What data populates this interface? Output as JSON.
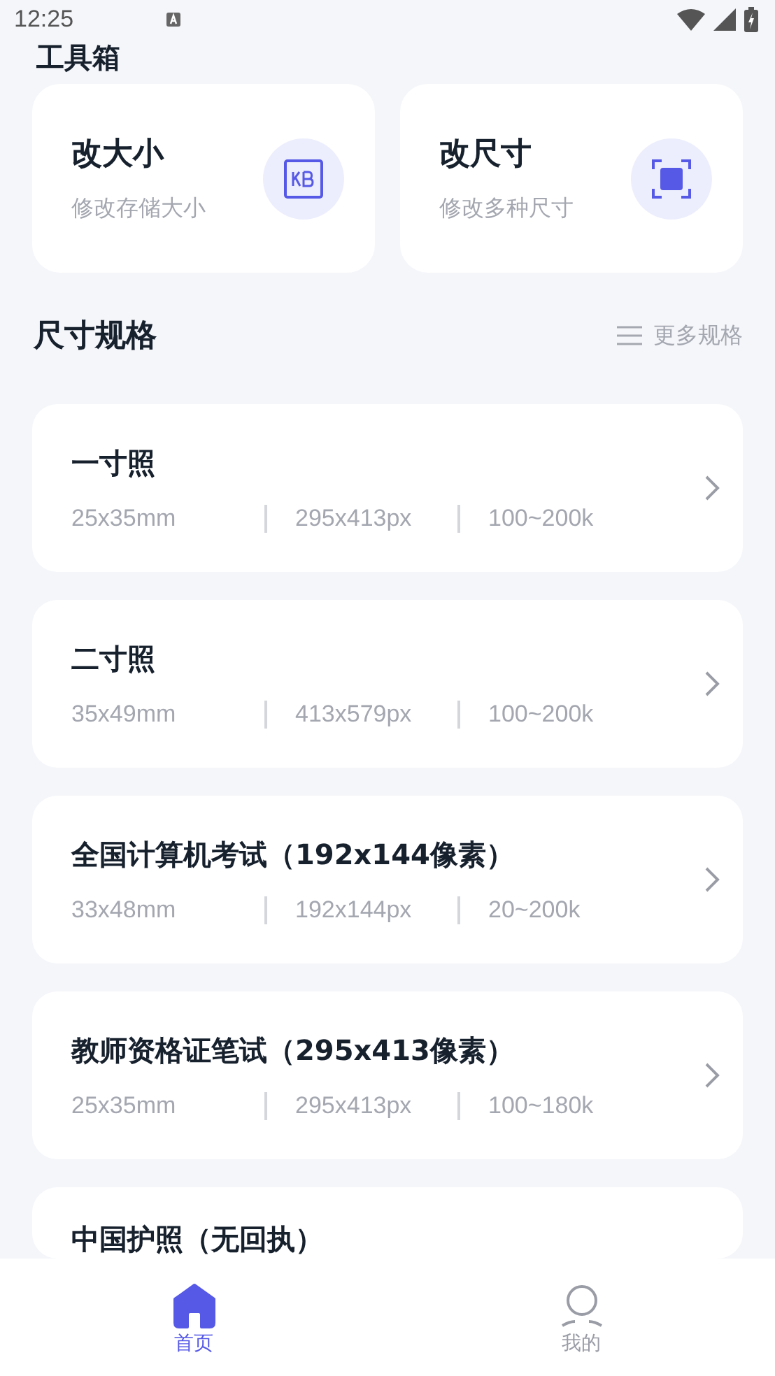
{
  "status_bar": {
    "time": "12:25"
  },
  "header": {
    "title": "工具箱"
  },
  "tools": [
    {
      "title": "改大小",
      "subtitle": "修改存储大小",
      "kind": "kb"
    },
    {
      "title": "改尺寸",
      "subtitle": "修改多种尺寸",
      "kind": "scan"
    }
  ],
  "section": {
    "title": "尺寸规格",
    "more": "更多规格"
  },
  "specs": [
    {
      "name": "一寸照",
      "size": "25x35mm",
      "pixels": "295x413px",
      "filesize": "100~200k"
    },
    {
      "name": "二寸照",
      "size": "35x49mm",
      "pixels": "413x579px",
      "filesize": "100~200k"
    },
    {
      "name": "全国计算机考试（192x144像素）",
      "size": "33x48mm",
      "pixels": "192x144px",
      "filesize": "20~200k"
    },
    {
      "name": "教师资格证笔试（295x413像素）",
      "size": "25x35mm",
      "pixels": "295x413px",
      "filesize": "100~180k"
    },
    {
      "name": "中国护照（无回执）"
    }
  ],
  "tabs": [
    {
      "label": "首页",
      "kind": "home",
      "selected": true
    },
    {
      "label": "我的",
      "kind": "user",
      "selected": false
    }
  ]
}
